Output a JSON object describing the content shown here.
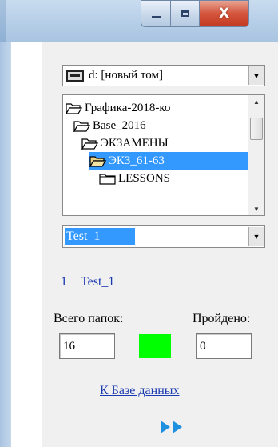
{
  "window": {
    "controls": {
      "minimize_icon": "minimize-icon",
      "maximize_icon": "maximize-icon",
      "close_glyph": "X"
    }
  },
  "drive": {
    "value": "d: [новый том]",
    "icon": "drive-icon"
  },
  "tree": {
    "items": [
      {
        "label": "Графика-2018-ко",
        "icon": "open-folder-icon",
        "selected": false
      },
      {
        "label": "Base_2016",
        "icon": "open-folder-icon",
        "selected": false
      },
      {
        "label": "ЭКЗАМЕНЫ",
        "icon": "open-folder-icon",
        "selected": false
      },
      {
        "label": "ЭКЗ_61-63",
        "icon": "open-folder-icon",
        "selected": true
      },
      {
        "label": "LESSONS",
        "icon": "folder-icon",
        "selected": false
      }
    ]
  },
  "test_select": {
    "value": "Test_1"
  },
  "current": {
    "number": "1",
    "name": "Test_1"
  },
  "stats": {
    "total_label": "Всего папок:",
    "passed_label": "Пройдено:",
    "total_value": "16",
    "passed_value": "0",
    "status_color": "#00ff00"
  },
  "link": {
    "label": "К Базе данных"
  },
  "nav": {
    "icon": "next-arrows-icon",
    "arrow_color": "#1f8fe0"
  },
  "colors": {
    "selection": "#3399ff",
    "link": "#1b3ab0"
  }
}
